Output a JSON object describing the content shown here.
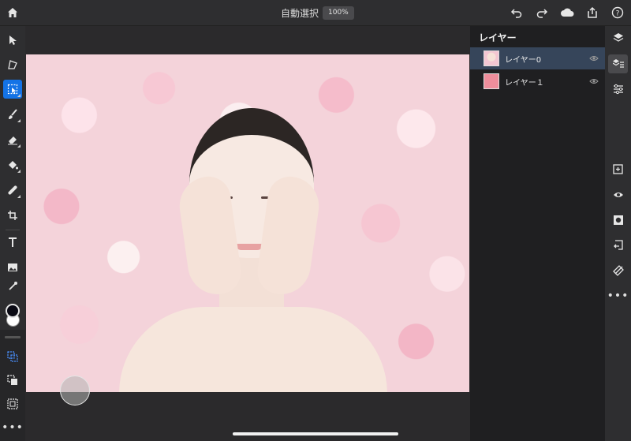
{
  "topbar": {
    "title": "自動選択",
    "zoom": "100%",
    "icons": [
      "home-icon",
      "undo-icon",
      "redo-icon",
      "cloud-icon",
      "share-icon",
      "help-icon"
    ]
  },
  "left_toolbar": {
    "tools": [
      "select-icon",
      "lasso-icon",
      "quick-select-icon",
      "brush-icon",
      "eraser-icon",
      "fill-icon",
      "heal-icon",
      "crop-icon",
      "text-icon",
      "image-icon",
      "eyedropper-icon"
    ],
    "active_tool": "quick-select-icon",
    "foreground_color": "#0a0a14",
    "background_color": "#ffffff",
    "lower_tools": [
      "selection-add-icon",
      "selection-subtract-icon",
      "selection-intersect-icon",
      "more-icon"
    ]
  },
  "layers_panel": {
    "title": "レイヤー",
    "layers": [
      {
        "name": "レイヤー0",
        "selected": true,
        "visible": true
      },
      {
        "name": "レイヤー１",
        "selected": false,
        "visible": true
      }
    ]
  },
  "right_toolbar": {
    "icons": [
      "layers-icon",
      "layer-properties-icon",
      "adjustments-icon",
      "add-layer-icon",
      "visibility-icon",
      "mask-icon",
      "import-icon",
      "clear-icon",
      "more-icon"
    ]
  }
}
